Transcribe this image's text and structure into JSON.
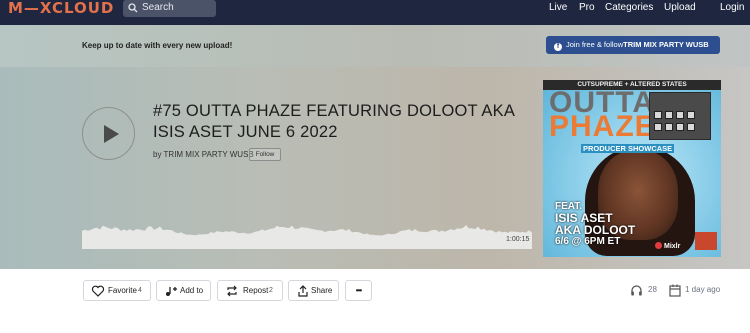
{
  "nav": {
    "logo": "M—XCLOUD",
    "search_placeholder": "Search",
    "links": [
      "Live",
      "Pro",
      "Categories",
      "Upload",
      "Login"
    ]
  },
  "banner": {
    "message": "Keep up to date with every new upload!",
    "join_prefix": "Join free & follow",
    "join_name": "TRIM MIX PARTY WUSB"
  },
  "show": {
    "title": "#75 OUTTA PHAZE FEATURING DOLOOT AKA ISIS ASET JUNE 6 2022",
    "byline": "by TRIM MIX PARTY WUSB",
    "follow_label": "Follow",
    "duration": "1:00:15"
  },
  "artwork": {
    "header": "CUTSUPREME + ALTERED STATES",
    "line1": "OUTTA",
    "line2": "PHAZE",
    "subtitle": "PRODUCER SHOWCASE",
    "feat": "FEAT.",
    "guest1": "ISIS ASET",
    "guest2": "AKA DOLOOT",
    "date": "6/6 @ 6PM ET",
    "badge": "Mixlr"
  },
  "actions": {
    "favorite_label": "Favorite",
    "favorite_count": "4",
    "add_label": "Add to",
    "repost_label": "Repost",
    "repost_count": "2",
    "share_label": "Share",
    "more_label": "•••"
  },
  "stats": {
    "plays": "28",
    "posted": "1 day ago"
  },
  "colors": {
    "nav_bg": "#1e2640",
    "logo": "#e3714b",
    "join_button": "#2d4f8f"
  }
}
